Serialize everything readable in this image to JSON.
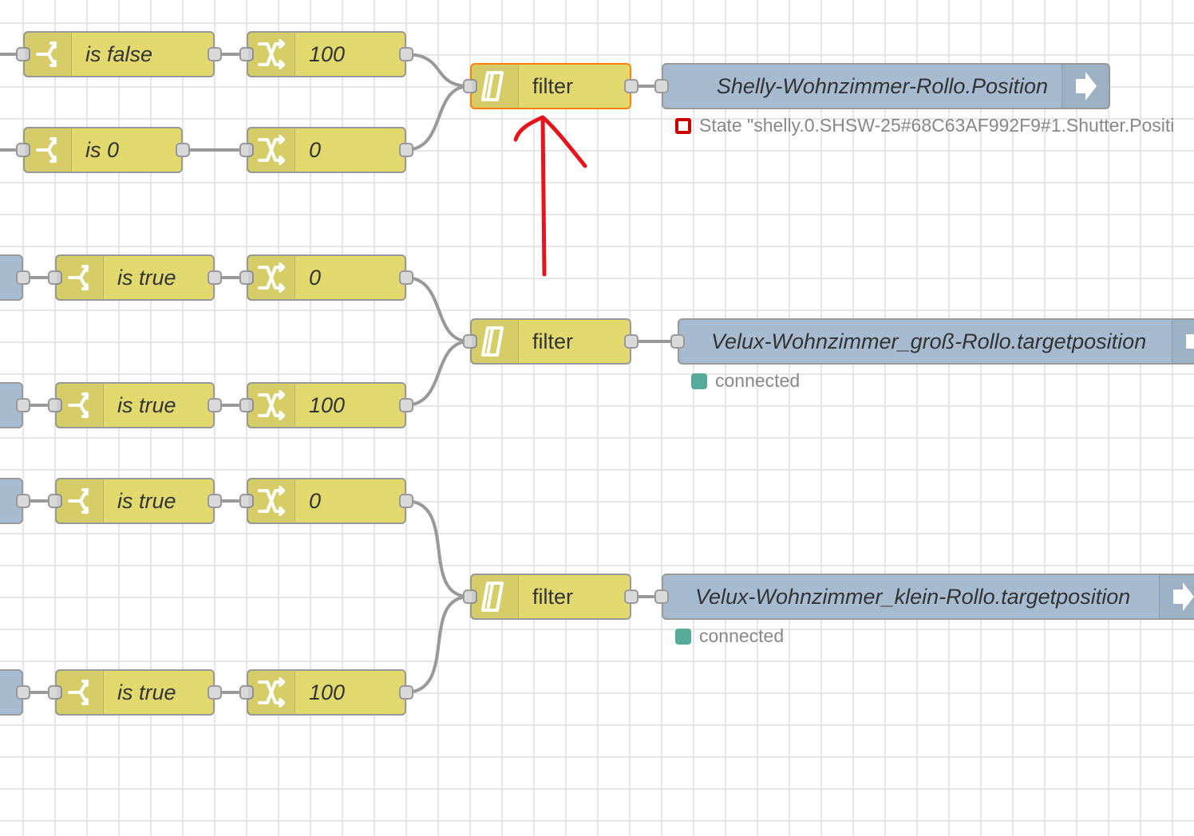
{
  "flow": {
    "group1": {
      "switch_top_label": "is false",
      "change_top_label": "100",
      "switch_bottom_label": "is 0",
      "change_bottom_label": "0",
      "filter_label": "filter",
      "output_label": "Shelly-Wohnzimmer-Rollo.Position",
      "status_text": "State \"shelly.0.SHSW-25#68C63AF992F9#1.Shutter.Positi"
    },
    "group2": {
      "switch_top_label": "is true",
      "change_top_label": "0",
      "switch_bottom_label": "is true",
      "change_bottom_label": "100",
      "filter_label": "filter",
      "output_label": "Velux-Wohnzimmer_groß-Rollo.targetposition",
      "status_text": "connected"
    },
    "group3": {
      "switch_top_label": "is true",
      "change_top_label": "0",
      "switch_bottom_label": "is true",
      "change_bottom_label": "100",
      "filter_label": "filter",
      "output_label": "Velux-Wohnzimmer_klein-Rollo.targetposition",
      "status_text": "connected"
    }
  },
  "icons": {
    "switch": "switch-icon",
    "change": "change-icon",
    "filter": "filter-icon",
    "output": "arrow-right-icon"
  },
  "colors": {
    "function_node": "#e2d96e",
    "io_node": "#a6bbcf",
    "selected_border": "#ff7f0e",
    "status_connected": "#55aa99",
    "status_error": "#cc0000",
    "annotation_arrow": "#e8141c",
    "wire": "#999999"
  }
}
